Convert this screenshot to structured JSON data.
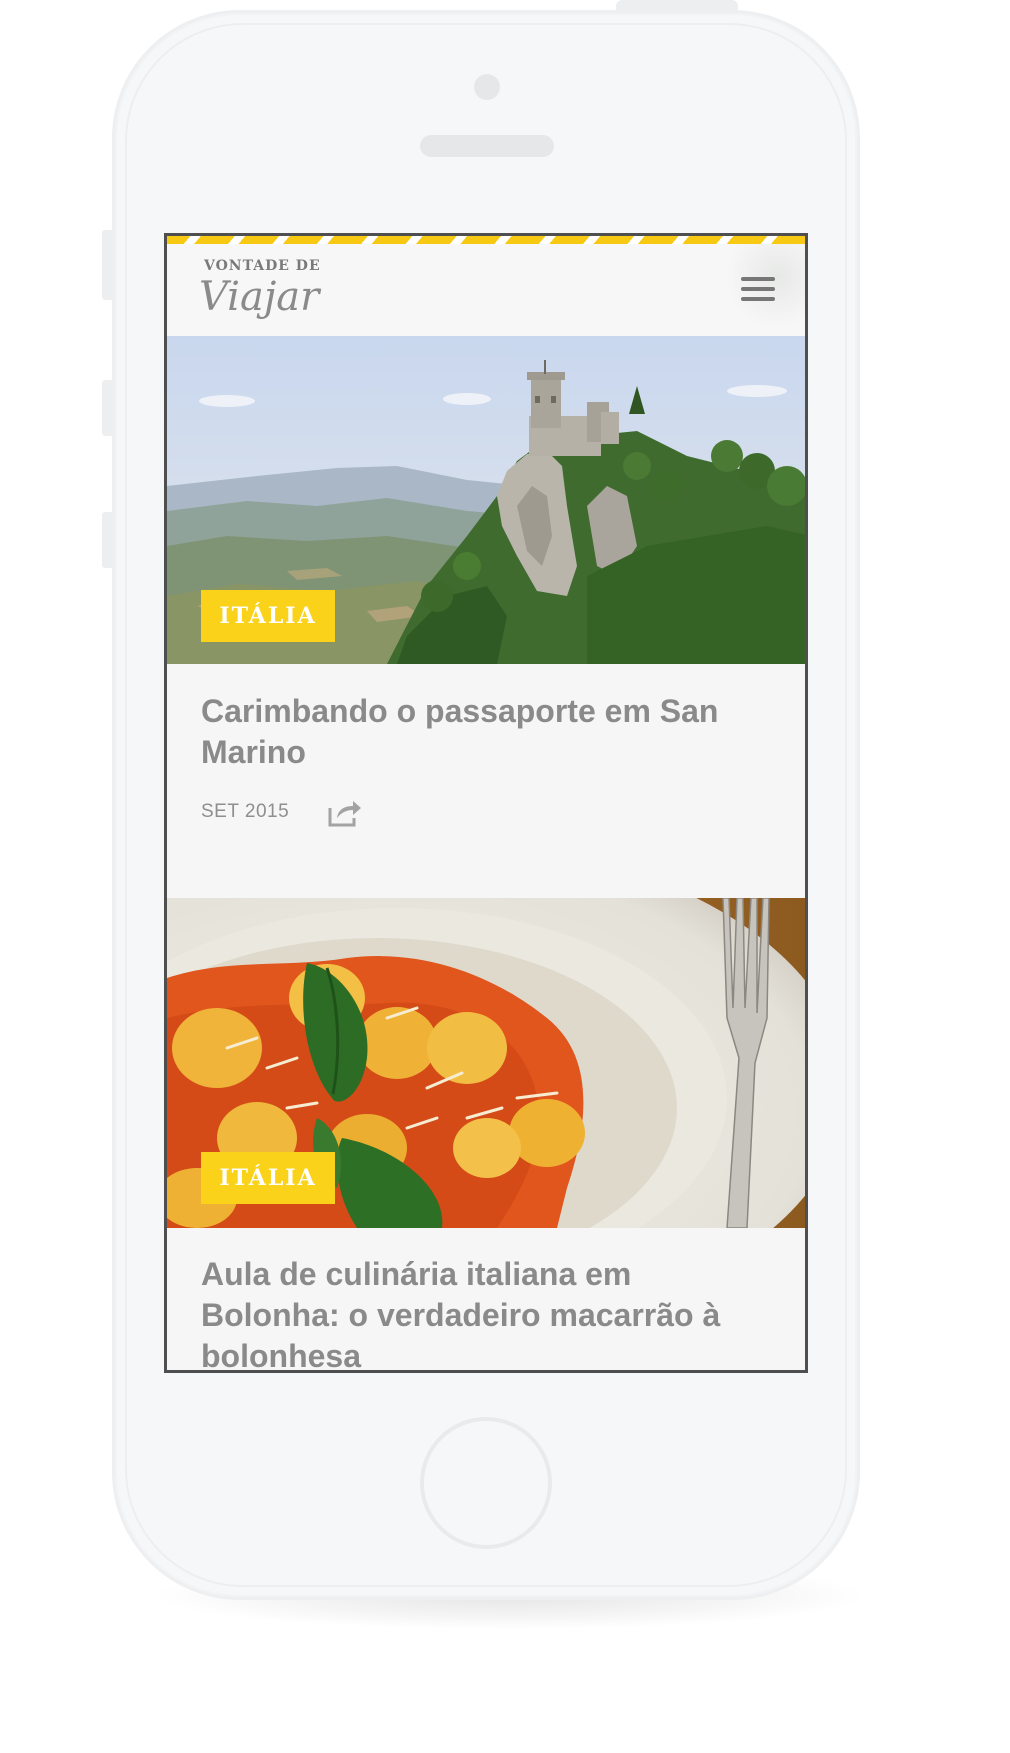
{
  "brand": {
    "line1": "VONTADE DE",
    "line2": "Viajar",
    "accent_color": "#fad21a"
  },
  "header": {
    "menu_icon": "hamburger-menu-icon"
  },
  "posts": [
    {
      "category": "ITÁLIA",
      "title": "Carimbando o passaporte em San Marino",
      "date": "SET 2015",
      "share_icon": "share-icon"
    },
    {
      "category": "ITÁLIA",
      "title": "Aula de culinária italiana em Bolonha: o verdadeiro macarrão à bolonhesa"
    }
  ]
}
